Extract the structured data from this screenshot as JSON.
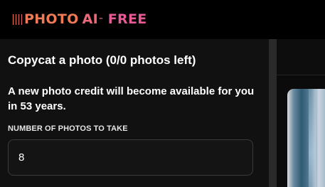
{
  "header": {
    "logo": {
      "photo": "PHOTO",
      "ai": "AI",
      "tm": "™",
      "free": "FREE"
    },
    "logo_bar_colors": [
      "#f07a4a",
      "#ef7256",
      "#ed6a62",
      "#eb626e"
    ]
  },
  "main": {
    "title": "Copycat a photo (0/0 photos left)",
    "credit_message": "A new photo credit will become available for you in 53 years.",
    "photos_field": {
      "label": "NUMBER OF PHOTOS TO TAKE",
      "value": "8"
    }
  },
  "colors": {
    "background": "#000000",
    "panel": "#111111",
    "accent_orange": "#ef7a55",
    "accent_pink": "#e65a96"
  }
}
